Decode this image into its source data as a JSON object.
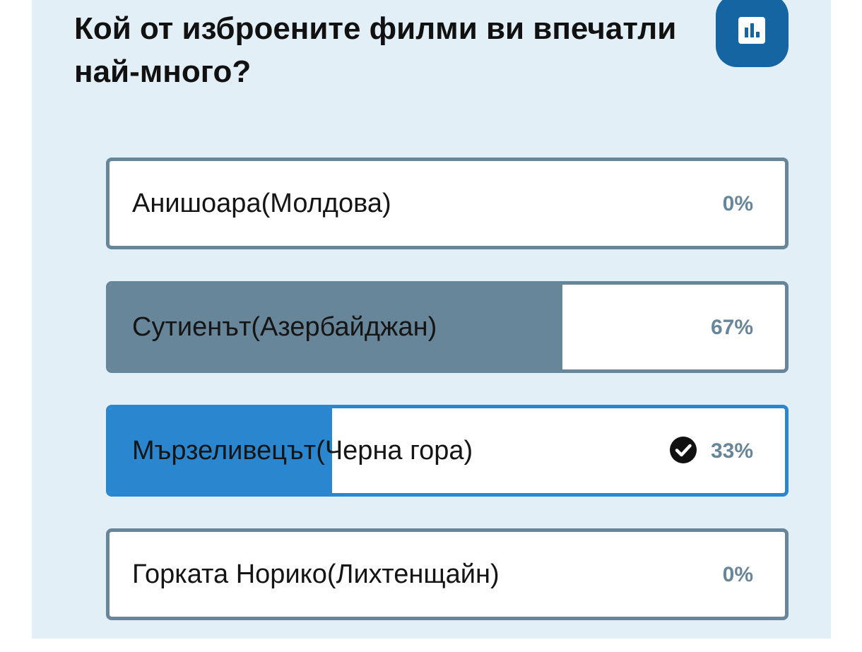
{
  "poll": {
    "question": "Кой от изброените филми ви впечатли най-много?",
    "results_icon": "bar-chart-icon",
    "options": [
      {
        "label": "Анишоара(Молдова)",
        "percent": 0,
        "percent_label": "0%",
        "selected": false
      },
      {
        "label": "Сутиенът(Азербайджан)",
        "percent": 67,
        "percent_label": "67%",
        "selected": false
      },
      {
        "label": "Мързеливецът(Черна гора)",
        "percent": 33,
        "percent_label": "33%",
        "selected": true,
        "selected_icon": "check-circle-icon"
      },
      {
        "label": "Горката Норико(Лихтенщайн)",
        "percent": 0,
        "percent_label": "0%",
        "selected": false
      }
    ]
  },
  "colors": {
    "card_background": "#e3eff7",
    "accent": "#1565a3",
    "result_fill": "#688699",
    "selected_fill": "#2a87cf"
  }
}
